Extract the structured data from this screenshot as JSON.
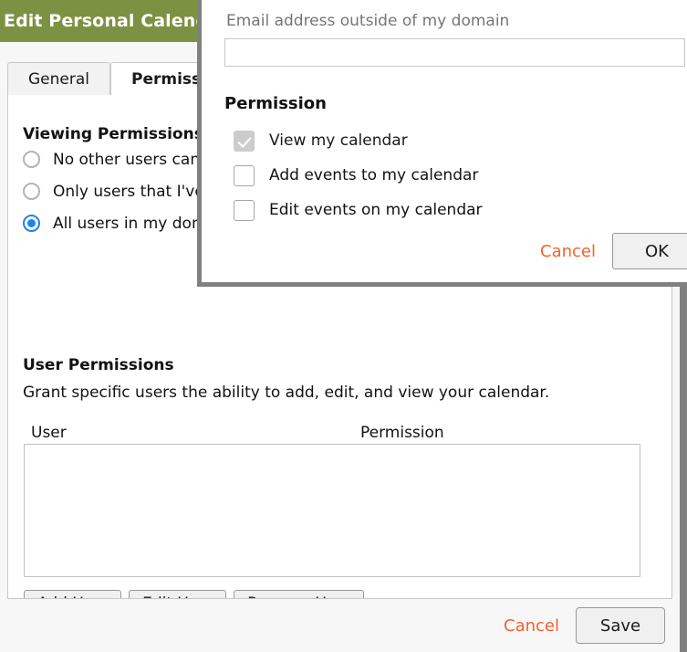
{
  "dialog": {
    "title": "Edit Personal Calendar",
    "titlebar_color": "#7d9142",
    "accent_link_color": "#f4622a",
    "tabs": [
      {
        "label": "General",
        "active": false
      },
      {
        "label": "Permissions",
        "active": true
      }
    ],
    "footer": {
      "cancel_label": "Cancel",
      "save_label": "Save"
    }
  },
  "permissions_tab": {
    "viewing": {
      "heading": "Viewing Permissions",
      "options": [
        {
          "label": "No other users can view my calendar",
          "selected": false
        },
        {
          "label": "Only users that I've granted permission to",
          "selected": false
        },
        {
          "label": "All users in my domain can view my calendar",
          "selected": true
        }
      ]
    },
    "user_permissions": {
      "heading": "User Permissions",
      "description": "Grant specific users the ability to add, edit, and view your calendar.",
      "columns": [
        "User",
        "Permission"
      ],
      "rows": [],
      "buttons": [
        {
          "label": "Add User"
        },
        {
          "label": "Edit User"
        },
        {
          "label": "Remove User"
        }
      ]
    }
  },
  "modal": {
    "email_label": "Email address outside of my domain",
    "email_value": "",
    "email_placeholder": "",
    "permission_heading": "Permission",
    "permission_options": [
      {
        "label": "View my calendar",
        "checked": true,
        "disabled": true
      },
      {
        "label": "Add events to my calendar",
        "checked": false,
        "disabled": false
      },
      {
        "label": "Edit events on my calendar",
        "checked": false,
        "disabled": false
      }
    ],
    "cancel_label": "Cancel",
    "ok_label": "OK"
  }
}
